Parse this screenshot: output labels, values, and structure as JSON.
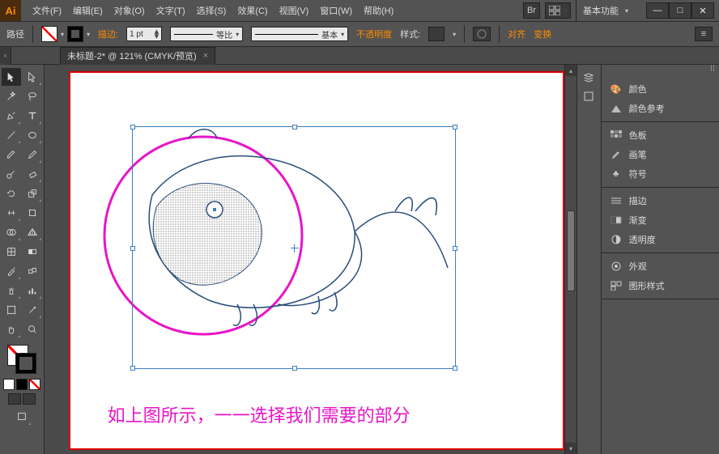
{
  "app_logo": "Ai",
  "menu": {
    "file": "文件(F)",
    "edit": "编辑(E)",
    "object": "对象(O)",
    "type": "文字(T)",
    "select": "选择(S)",
    "effect": "效果(C)",
    "view": "视图(V)",
    "window": "窗口(W)",
    "help": "帮助(H)"
  },
  "workspace": {
    "label": "基本功能",
    "br_label": "Br"
  },
  "control": {
    "path_label": "路径",
    "stroke_label": "描边:",
    "stroke_value": "1 pt",
    "uniform": "等比",
    "basic": "基本",
    "opacity": "不透明度",
    "style_label": "样式:",
    "align": "对齐",
    "transform": "变换"
  },
  "tab": {
    "title": "未标题-2* @ 121% (CMYK/预览)",
    "close": "×"
  },
  "canvas": {
    "caption": "如上图所示，一一选择我们需要的部分"
  },
  "panels": {
    "color": "颜色",
    "color_guide": "颜色参考",
    "swatches": "色板",
    "brushes": "画笔",
    "symbols": "符号",
    "stroke": "描边",
    "gradient": "渐变",
    "transparency": "透明度",
    "appearance": "外观",
    "graphic_styles": "图形样式"
  },
  "icons": {
    "minimize": "—",
    "maximize": "□",
    "close": "✕",
    "chev_down": "▾",
    "chev_right": "▸",
    "chev_left": "◂",
    "search": "🔍"
  }
}
